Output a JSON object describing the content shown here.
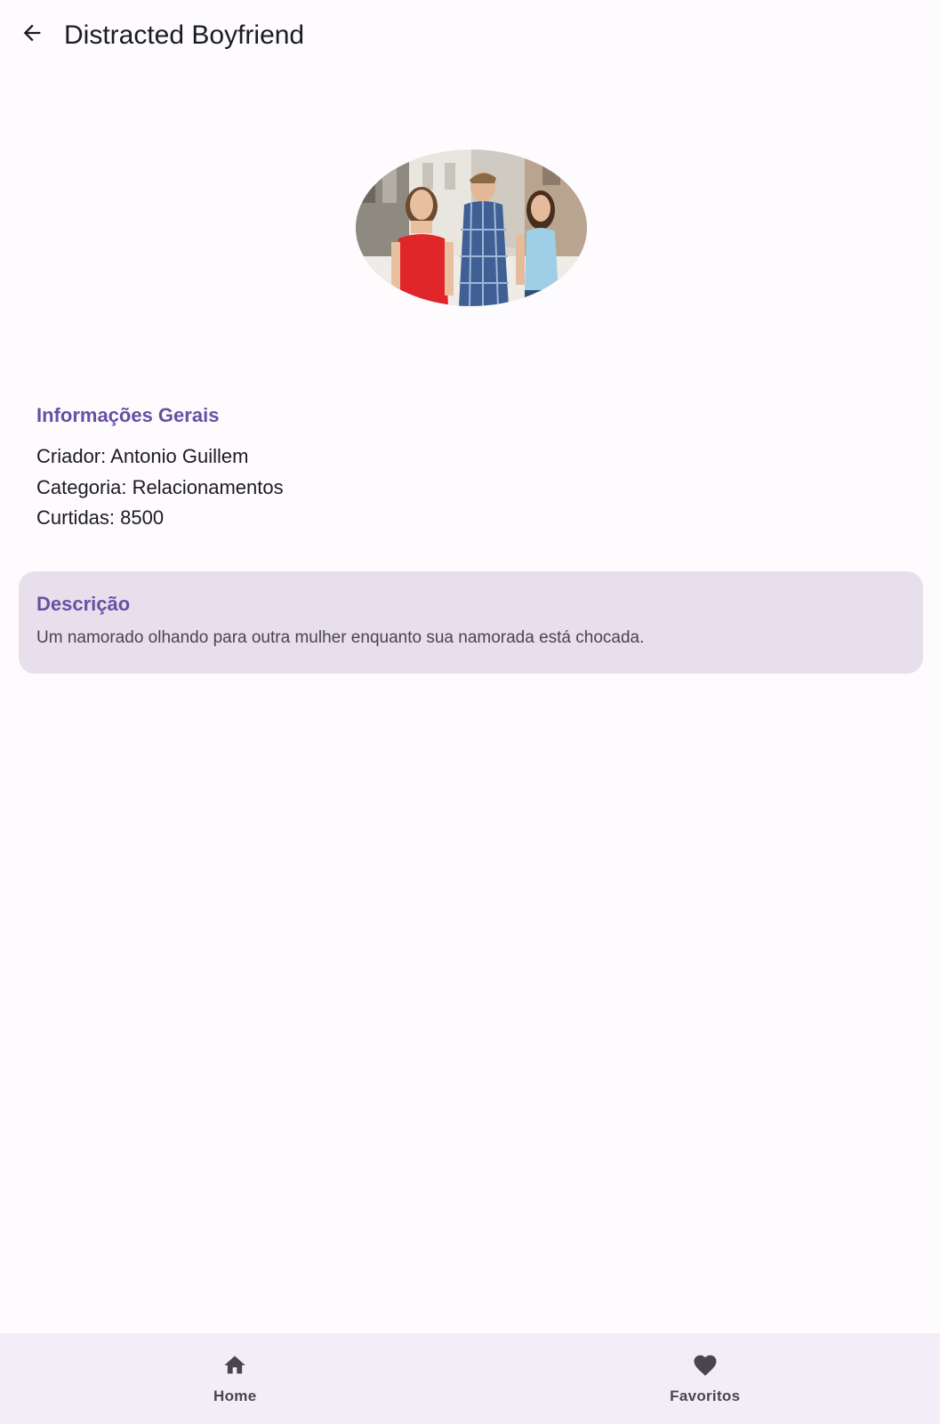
{
  "header": {
    "back_icon": "arrow-back-icon",
    "title": "Distracted Boyfriend"
  },
  "meme": {
    "image_icon": "meme-photo"
  },
  "info": {
    "section_title": "Informações Gerais",
    "creator_line": "Criador: Antonio Guillem",
    "category_line": "Categoria: Relacionamentos",
    "likes_line": "Curtidas: 8500"
  },
  "description": {
    "title": "Descrição",
    "text": "Um namorado olhando para outra mulher enquanto sua namorada está chocada."
  },
  "bottom_nav": {
    "items": [
      {
        "label": "Home",
        "icon": "home-icon"
      },
      {
        "label": "Favoritos",
        "icon": "heart-icon"
      }
    ]
  },
  "colors": {
    "background": "#fefbfe",
    "accent": "#6750a4",
    "card": "#e7e0ec",
    "nav_background": "#f3edf7"
  }
}
